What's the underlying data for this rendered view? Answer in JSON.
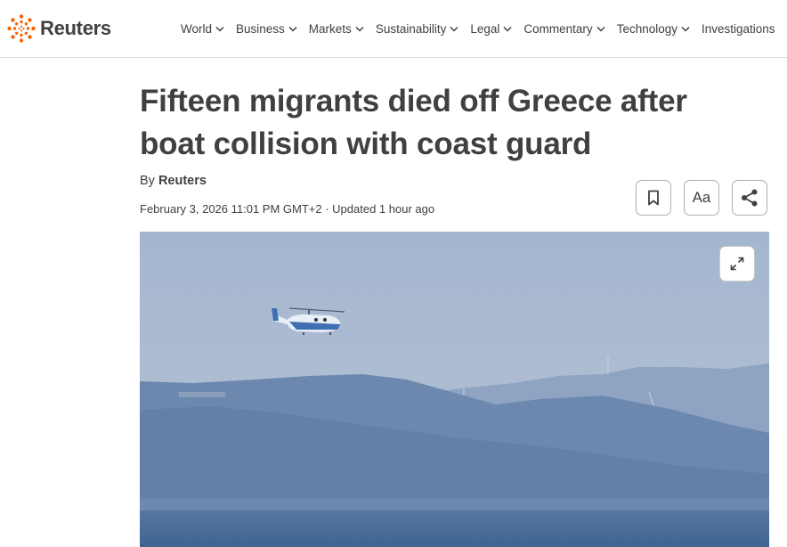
{
  "brand": {
    "name": "Reuters",
    "accent_color": "#fa6400"
  },
  "nav": {
    "items": [
      {
        "label": "World"
      },
      {
        "label": "Business"
      },
      {
        "label": "Markets"
      },
      {
        "label": "Sustainability"
      },
      {
        "label": "Legal"
      },
      {
        "label": "Commentary"
      },
      {
        "label": "Technology"
      },
      {
        "label": "Investigations"
      }
    ]
  },
  "article": {
    "headline": "Fifteen migrants died off Greece after boat collision with coast guard",
    "byline_prefix": "By",
    "author": "Reuters",
    "dateline": "February 3, 2026 11:01 PM GMT+2 · Updated 1 hour ago",
    "tools": {
      "bookmark_icon": "bookmark-icon",
      "font_size_label": "Aa",
      "share_icon": "share-icon"
    },
    "image": {
      "description_icon": "expand-icon",
      "subject": "coast guard helicopter over sea with hills"
    }
  }
}
